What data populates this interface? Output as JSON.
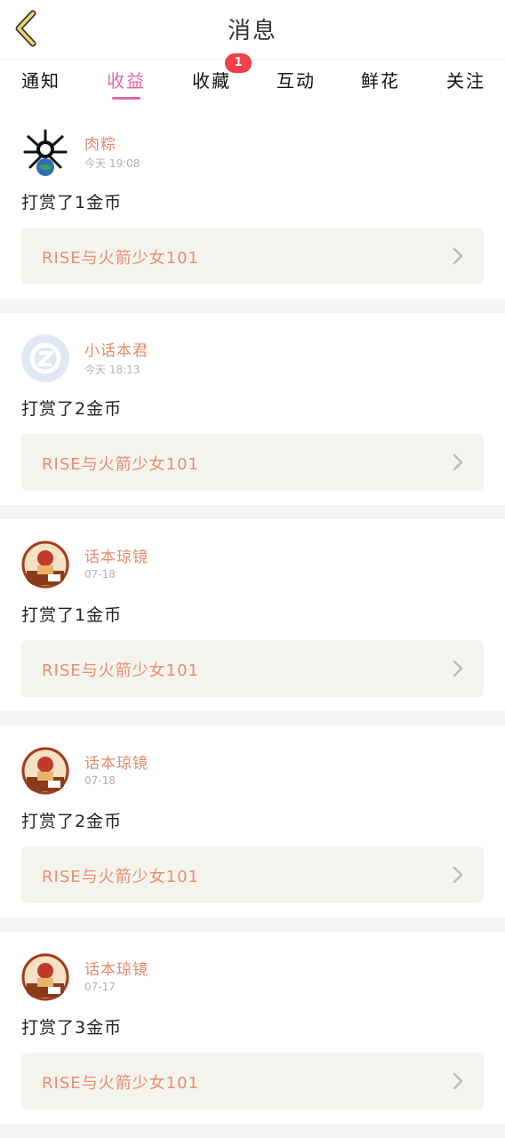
{
  "header": {
    "title": "消息"
  },
  "tabs": [
    {
      "label": "通知"
    },
    {
      "label": "收益"
    },
    {
      "label": "收藏"
    },
    {
      "label": "互动"
    },
    {
      "label": "鲜花"
    },
    {
      "label": "关注"
    }
  ],
  "tab_badge": "1",
  "items": [
    {
      "user": "肉粽",
      "time": "今天 19:08",
      "message": "打赏了1金币",
      "work": "RISE与火箭少女101",
      "avatar": "black-white-art-avatar"
    },
    {
      "user": "小话本君",
      "time": "今天 18:13",
      "message": "打赏了2金币",
      "work": "RISE与火箭少女101",
      "avatar": "default-blue-avatar"
    },
    {
      "user": "话本琼镜",
      "time": "07-18",
      "message": "打赏了1金币",
      "work": "RISE与火箭少女101",
      "avatar": "illustrated-avatar"
    },
    {
      "user": "话本琼镜",
      "time": "07-18",
      "message": "打赏了2金币",
      "work": "RISE与火箭少女101",
      "avatar": "illustrated-avatar"
    },
    {
      "user": "话本琼镜",
      "time": "07-17",
      "message": "打赏了3金币",
      "work": "RISE与火箭少女101",
      "avatar": "illustrated-avatar"
    }
  ],
  "colors": {
    "accent": "#e06aa0",
    "username": "#e8896b",
    "work_title": "#eb8e6e",
    "badge": "#f0404a",
    "back_arrow": "#d6b24a"
  }
}
